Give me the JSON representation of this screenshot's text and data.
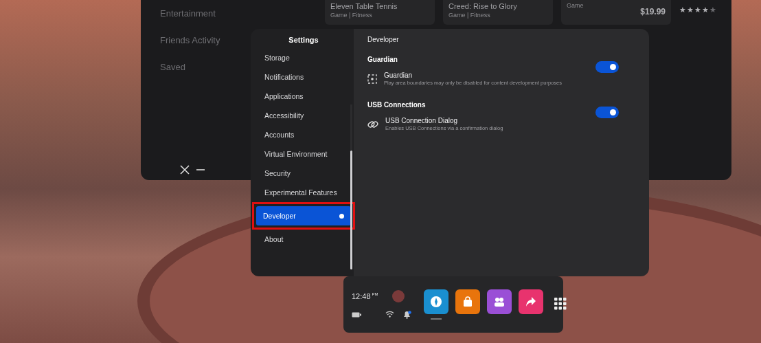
{
  "back_panel": {
    "sidebar_items": [
      "Entertainment",
      "Friends Activity",
      "Saved"
    ],
    "tiles": [
      {
        "title": "Eleven Table Tennis",
        "subtitle": "Game | Fitness"
      },
      {
        "title": "Creed: Rise to Glory",
        "subtitle": "Game | Fitness"
      },
      {
        "subtitle": "Game",
        "price": "$19.99"
      }
    ],
    "stars": 4
  },
  "settings": {
    "title": "Settings",
    "items": [
      {
        "label": "Storage",
        "selected": false
      },
      {
        "label": "Notifications",
        "selected": false
      },
      {
        "label": "Applications",
        "selected": false
      },
      {
        "label": "Accessibility",
        "selected": false
      },
      {
        "label": "Accounts",
        "selected": false
      },
      {
        "label": "Virtual Environment",
        "selected": false
      },
      {
        "label": "Security",
        "selected": false
      },
      {
        "label": "Experimental Features",
        "selected": false
      },
      {
        "label": "Developer",
        "selected": true
      },
      {
        "label": "About",
        "selected": false
      }
    ],
    "header": "Developer",
    "sections": [
      {
        "title": "Guardian",
        "items": [
          {
            "kind": "guardian",
            "title": "Guardian",
            "description": "Play area boundaries may only be disabled for content development purposes",
            "on": true
          }
        ]
      },
      {
        "title": "USB Connections",
        "items": [
          {
            "kind": "link",
            "title": "USB Connection Dialog",
            "description": "Enables USB Connections via a confirmation dialog",
            "on": true
          }
        ]
      }
    ]
  },
  "taskbar": {
    "time": "12:48",
    "meridiem": "PM",
    "notification_badge": true,
    "apps": [
      {
        "kind": "explore",
        "color": "#1a8fd0",
        "selected": true
      },
      {
        "kind": "store",
        "color": "#e8740c",
        "selected": false
      },
      {
        "kind": "people",
        "color": "#9a4fd6",
        "selected": false
      },
      {
        "kind": "share",
        "color": "#e8336e",
        "selected": false
      }
    ]
  }
}
